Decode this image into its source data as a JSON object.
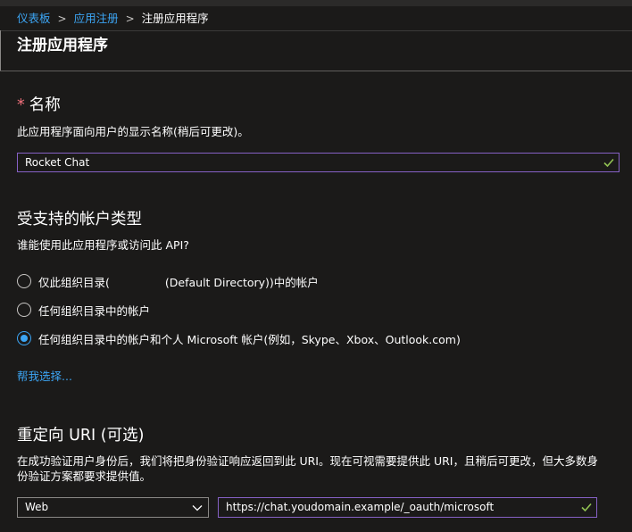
{
  "breadcrumb": {
    "items": [
      "仪表板",
      "应用注册"
    ],
    "current": "注册应用程序",
    "separator": ">"
  },
  "page": {
    "title": "注册应用程序"
  },
  "name_section": {
    "required_marker": "*",
    "title": "名称",
    "description": "此应用程序面向用户的显示名称(稍后可更改)。",
    "input_value": "Rocket Chat"
  },
  "account_section": {
    "title": "受支持的帐户类型",
    "question": "谁能使用此应用程序或访问此 API?",
    "options": [
      {
        "label_a": "仅此组织目录(",
        "label_b": "(Default Directory))中的帐户",
        "selected": false
      },
      {
        "label": "任何组织目录中的帐户",
        "selected": false
      },
      {
        "label": "任何组织目录中的帐户和个人 Microsoft 帐户(例如，Skype、Xbox、Outlook.com)",
        "selected": true
      }
    ],
    "help_link": "帮我选择..."
  },
  "redirect_section": {
    "title": "重定向 URI (可选)",
    "description_line1": "在成功验证用户身份后，我们将把身份验证响应返回到此 URI。现在可视需要提供此 URI，且稍后可更改，但大多数身",
    "description_line2": "份验证方案都要求提供值。",
    "platform_value": "Web",
    "uri_value": "https://chat.youdomain.example/_oauth/microsoft"
  },
  "icons": {
    "check": "checkmark-icon",
    "chevron": "chevron-down-icon"
  },
  "colors": {
    "background": "#1b1a19",
    "link": "#3ca5f4",
    "focus_border": "#8661c5",
    "check": "#92c353",
    "required": "#f1707b"
  }
}
